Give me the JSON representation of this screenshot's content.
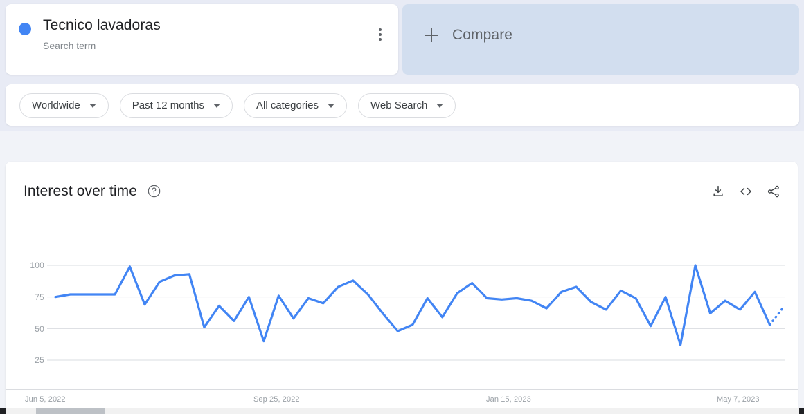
{
  "search_term": {
    "title": "Tecnico lavadoras",
    "subtitle": "Search term",
    "dot_color": "#4285F4",
    "menu_icon": "more-vert-icon"
  },
  "compare": {
    "label": "Compare",
    "icon": "plus-icon",
    "background": "#D2DEEF"
  },
  "filters": [
    {
      "label": "Worldwide",
      "icon": "chevron-down-icon"
    },
    {
      "label": "Past 12 months",
      "icon": "chevron-down-icon"
    },
    {
      "label": "All categories",
      "icon": "chevron-down-icon"
    },
    {
      "label": "Web Search",
      "icon": "chevron-down-icon"
    }
  ],
  "chart_panel": {
    "title": "Interest over time",
    "help_icon": "help-circle-icon",
    "actions": [
      {
        "name": "download-icon",
        "tooltip": "Download"
      },
      {
        "name": "embed-code-icon",
        "tooltip": "Embed"
      },
      {
        "name": "share-icon",
        "tooltip": "Share"
      }
    ]
  },
  "chart_data": {
    "type": "line",
    "title": "Interest over time",
    "xlabel": "",
    "ylabel": "",
    "ylim": [
      0,
      110
    ],
    "yticks": [
      25,
      50,
      75,
      100
    ],
    "ytick_labels": [
      "25",
      "50",
      "75",
      "100"
    ],
    "grid": true,
    "legend": false,
    "line_color": "#4285F4",
    "series_name": "Tecnico lavadoras",
    "x_range": [
      "Jun 5, 2022",
      "May 28, 2023"
    ],
    "xtick_labels": [
      "Jun 5, 2022",
      "Sep 25, 2022",
      "Jan 15, 2023",
      "May 7, 2023"
    ],
    "xtick_positions": [
      0,
      16,
      32,
      48
    ],
    "partial_data_note": "Final dotted segment indicates incomplete data",
    "values": [
      75,
      77,
      77,
      77,
      77,
      99,
      69,
      87,
      92,
      93,
      51,
      68,
      56,
      75,
      40,
      76,
      58,
      74,
      70,
      83,
      88,
      77,
      62,
      48,
      53,
      74,
      59,
      78,
      86,
      74,
      73,
      74,
      72,
      66,
      79,
      83,
      71,
      65,
      80,
      74,
      52,
      75,
      37,
      100,
      62,
      72,
      65,
      79,
      53,
      68
    ],
    "solid_point_count": 49,
    "dotted_point_count": 2,
    "max_value": 100,
    "min_value": 37
  },
  "scrollbar": {
    "orientation": "horizontal",
    "thumb_color": "#BDC1C6"
  }
}
